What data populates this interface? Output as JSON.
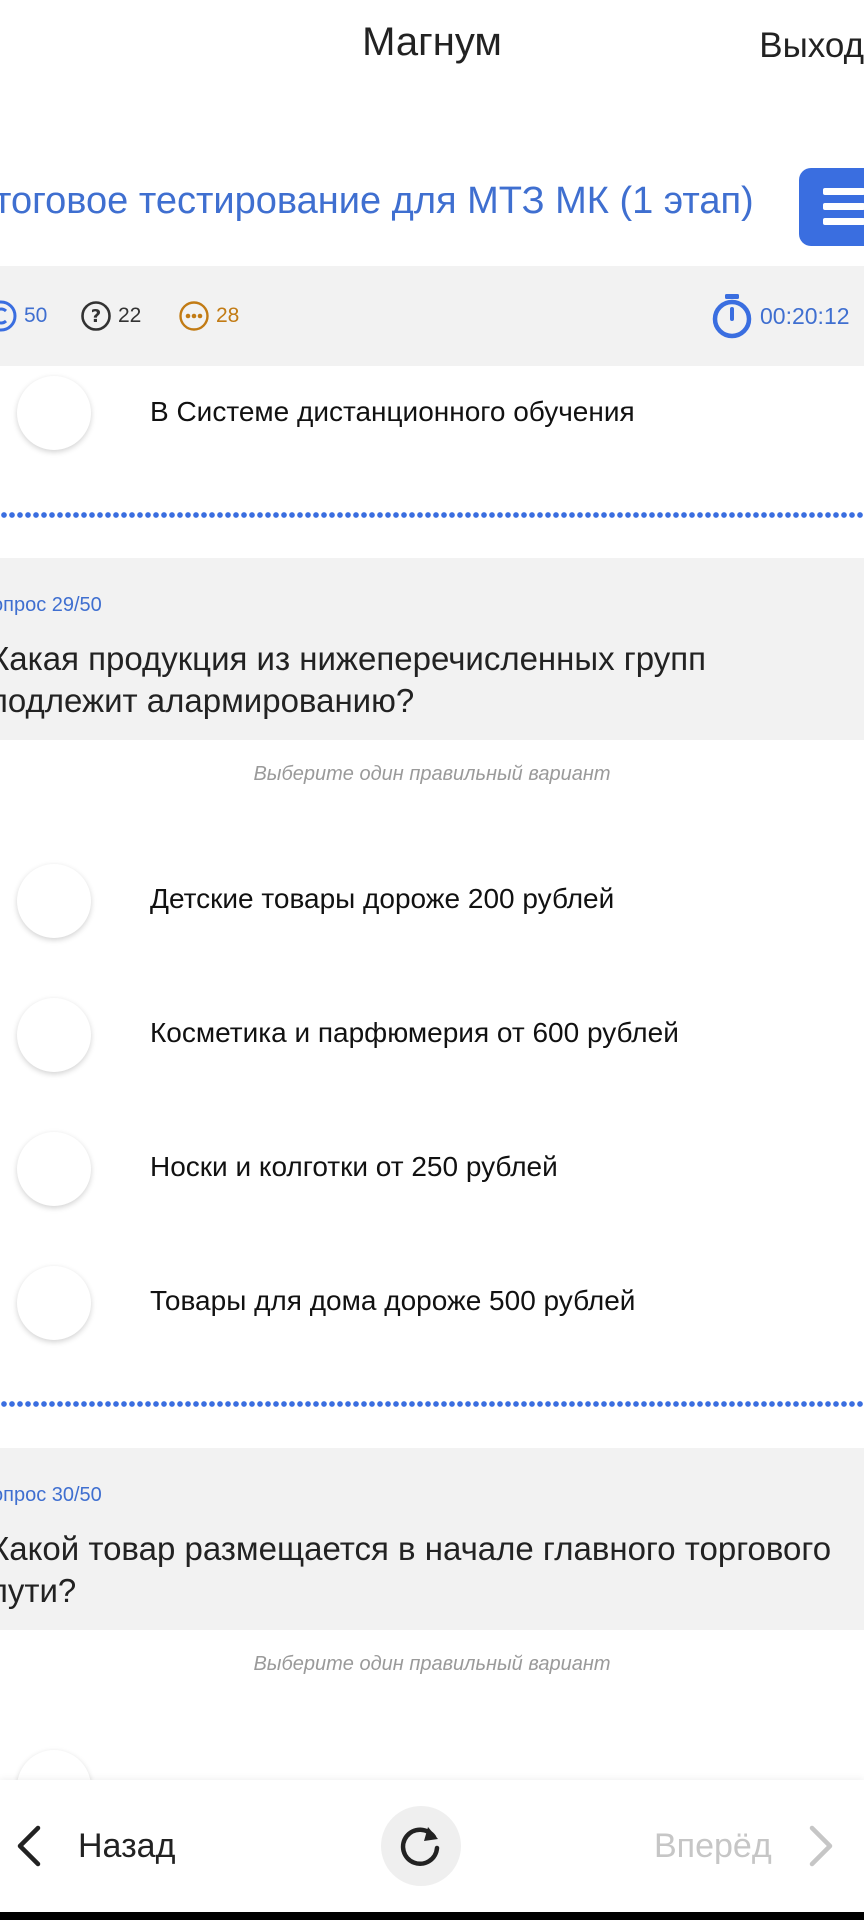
{
  "header": {
    "title": "Магнум",
    "exit_label": "Выход"
  },
  "test": {
    "title": "тоговое тестирование для МТЗ МК (1 этап)"
  },
  "stats": {
    "total": "50",
    "unanswered": "22",
    "pending": "28",
    "timer": "00:20:12"
  },
  "prev_question": {
    "last_option": "В Системе дистанционного обучения"
  },
  "question_29": {
    "number": "опрос 29/50",
    "text": "Какая продукция из нижеперечисленных групп подлежит алармированию?",
    "hint": "Выберите один правильный вариант",
    "options": [
      "Детские товары дороже 200 рублей",
      "Косметика и парфюмерия от 600 рублей",
      "Носки и колготки от 250 рублей",
      "Товары для дома дороже 500 рублей"
    ]
  },
  "question_30": {
    "number": "опрос 30/50",
    "text": "Какой товар размещается в начале главного торгового пути?",
    "hint": "Выберите один правильный вариант"
  },
  "nav": {
    "back_label": "Назад",
    "forward_label": "Вперёд"
  },
  "colors": {
    "accent": "#3a6ee0",
    "pending": "#c27b14",
    "muted": "#c6c6c6"
  }
}
